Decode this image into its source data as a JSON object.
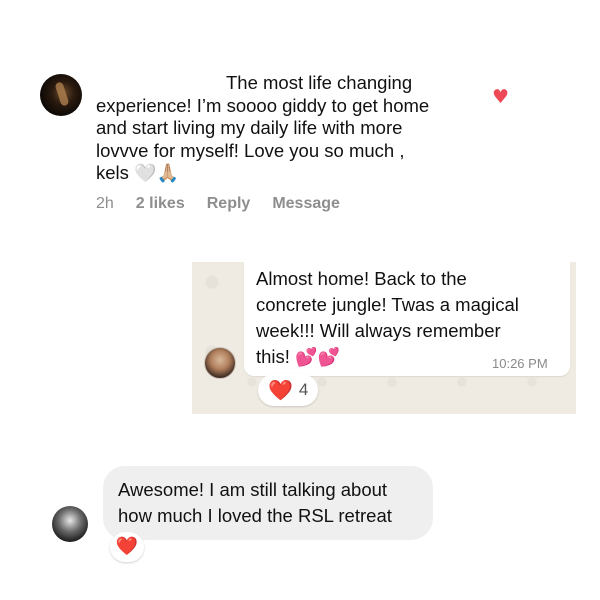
{
  "instagram_comment": {
    "text_lines": [
      "The most life changing",
      "experience! I’m soooo giddy to get home",
      "and start living my daily life with more",
      "lovvve for myself! Love you so much ,",
      "kels"
    ],
    "emojis": [
      "🤍",
      "🙏🏼"
    ],
    "like_icon": "heart-icon",
    "meta": {
      "time": "2h",
      "likes": "2 likes",
      "reply": "Reply",
      "message": "Message"
    },
    "colors": {
      "like": "#ed4956",
      "meta": "#8e8e8e"
    }
  },
  "whatsapp_message": {
    "text_lines": [
      "Almost home! Back to the",
      "concrete jungle! Twas a magical",
      "week!!! Will always remember",
      "this!"
    ],
    "emojis": [
      "💕",
      "💕"
    ],
    "time": "10:26 PM",
    "reaction": {
      "emoji": "❤️",
      "count": "4"
    },
    "colors": {
      "background": "#efeae2",
      "bubble": "#ffffff"
    }
  },
  "reply_bubble": {
    "text_lines": [
      "Awesome! I am still talking about",
      "how much I loved the RSL retreat"
    ],
    "reaction": {
      "emoji": "❤️"
    },
    "colors": {
      "bubble": "#efefef"
    }
  }
}
